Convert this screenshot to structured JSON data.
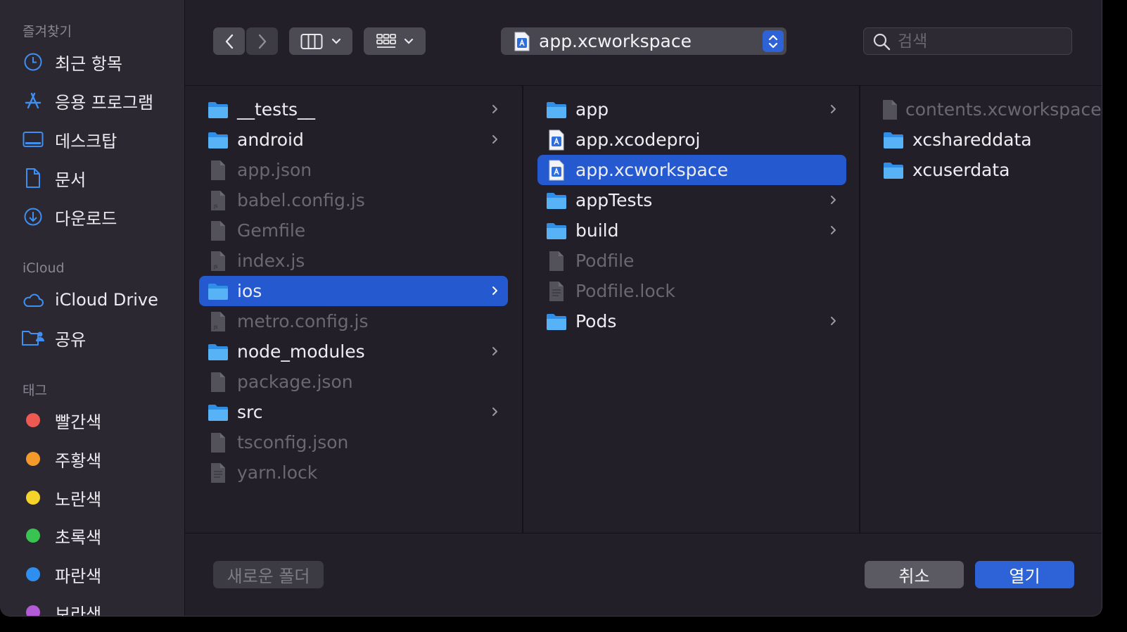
{
  "sidebar": {
    "favorites_header": "즐겨찾기",
    "favorites": [
      {
        "label": "최근 항목",
        "icon": "clock-icon"
      },
      {
        "label": "응용 프로그램",
        "icon": "applications-icon"
      },
      {
        "label": "데스크탑",
        "icon": "desktop-icon"
      },
      {
        "label": "문서",
        "icon": "document-icon"
      },
      {
        "label": "다운로드",
        "icon": "download-icon"
      }
    ],
    "icloud_header": "iCloud",
    "icloud": [
      {
        "label": "iCloud Drive",
        "icon": "cloud-icon"
      },
      {
        "label": "공유",
        "icon": "shared-folder-icon"
      }
    ],
    "tags_header": "태그",
    "tags": [
      {
        "label": "빨간색",
        "color": "#ee5a52"
      },
      {
        "label": "주황색",
        "color": "#f39a2b"
      },
      {
        "label": "노란색",
        "color": "#f5d328"
      },
      {
        "label": "초록색",
        "color": "#39c451"
      },
      {
        "label": "파란색",
        "color": "#2f8ff0"
      },
      {
        "label": "보라색",
        "color": "#b35bd6"
      }
    ]
  },
  "toolbar": {
    "path_title": "app.xcworkspace",
    "search_placeholder": "검색"
  },
  "columns": [
    {
      "items": [
        {
          "name": "__tests__",
          "type": "folder",
          "enabled": true,
          "has_children": true
        },
        {
          "name": "android",
          "type": "folder",
          "enabled": true,
          "has_children": true
        },
        {
          "name": "app.json",
          "type": "file",
          "enabled": false,
          "has_children": false
        },
        {
          "name": "babel.config.js",
          "type": "js",
          "enabled": false,
          "has_children": false
        },
        {
          "name": "Gemfile",
          "type": "file",
          "enabled": false,
          "has_children": false
        },
        {
          "name": "index.js",
          "type": "js",
          "enabled": false,
          "has_children": false
        },
        {
          "name": "ios",
          "type": "folder",
          "enabled": true,
          "has_children": true,
          "selected": true
        },
        {
          "name": "metro.config.js",
          "type": "js",
          "enabled": false,
          "has_children": false
        },
        {
          "name": "node_modules",
          "type": "folder",
          "enabled": true,
          "has_children": true
        },
        {
          "name": "package.json",
          "type": "file",
          "enabled": false,
          "has_children": false
        },
        {
          "name": "src",
          "type": "folder",
          "enabled": true,
          "has_children": true
        },
        {
          "name": "tsconfig.json",
          "type": "file",
          "enabled": false,
          "has_children": false
        },
        {
          "name": "yarn.lock",
          "type": "text",
          "enabled": false,
          "has_children": false
        }
      ]
    },
    {
      "items": [
        {
          "name": "app",
          "type": "folder",
          "enabled": true,
          "has_children": true
        },
        {
          "name": "app.xcodeproj",
          "type": "xcode",
          "enabled": true,
          "has_children": false
        },
        {
          "name": "app.xcworkspace",
          "type": "xcode",
          "enabled": true,
          "has_children": false,
          "selected": true
        },
        {
          "name": "appTests",
          "type": "folder",
          "enabled": true,
          "has_children": true
        },
        {
          "name": "build",
          "type": "folder",
          "enabled": true,
          "has_children": true
        },
        {
          "name": "Podfile",
          "type": "file",
          "enabled": false,
          "has_children": false
        },
        {
          "name": "Podfile.lock",
          "type": "text",
          "enabled": false,
          "has_children": false
        },
        {
          "name": "Pods",
          "type": "folder",
          "enabled": true,
          "has_children": true
        }
      ]
    },
    {
      "items": [
        {
          "name": "contents.xcworkspacedata",
          "type": "file",
          "enabled": false,
          "has_children": false
        },
        {
          "name": "xcshareddata",
          "type": "folder",
          "enabled": true,
          "has_children": false
        },
        {
          "name": "xcuserdata",
          "type": "folder",
          "enabled": true,
          "has_children": false
        }
      ]
    }
  ],
  "footer": {
    "new_folder": "새로운 폴더",
    "cancel": "취소",
    "open": "열기"
  }
}
